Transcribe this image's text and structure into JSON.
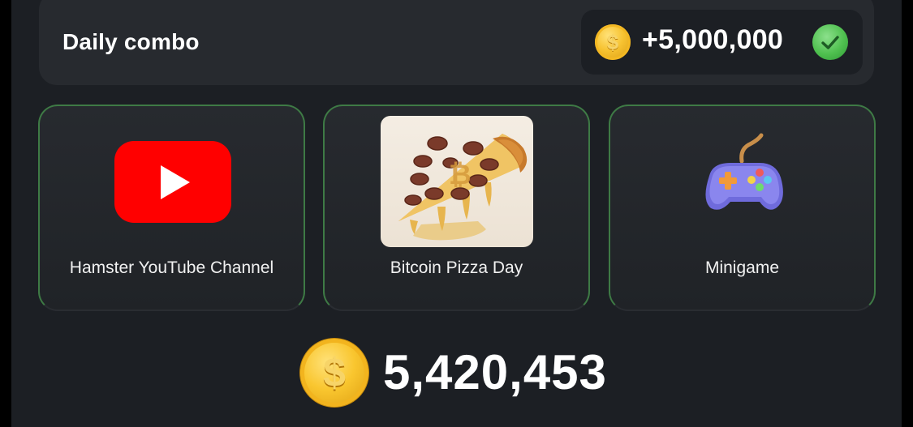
{
  "daily_combo": {
    "title": "Daily combo",
    "reward": "+5,000,000",
    "coin_icon": "dollar-coin-icon",
    "status_icon": "check-circle-icon",
    "status_color": "#4fc04f"
  },
  "cards": [
    {
      "label": "Hamster YouTube Channel",
      "icon": "youtube-logo-icon"
    },
    {
      "label": "Bitcoin Pizza Day",
      "icon": "bitcoin-pizza-image"
    },
    {
      "label": "Minigame",
      "icon": "gamepad-icon"
    }
  ],
  "balance": {
    "value": "5,420,453",
    "coin_icon": "dollar-coin-icon"
  },
  "colors": {
    "background": "#1c1f24",
    "card": "#272a2f",
    "card_border": "#3e7a45",
    "coin": "#f7c331",
    "youtube_red": "#ff0000"
  }
}
